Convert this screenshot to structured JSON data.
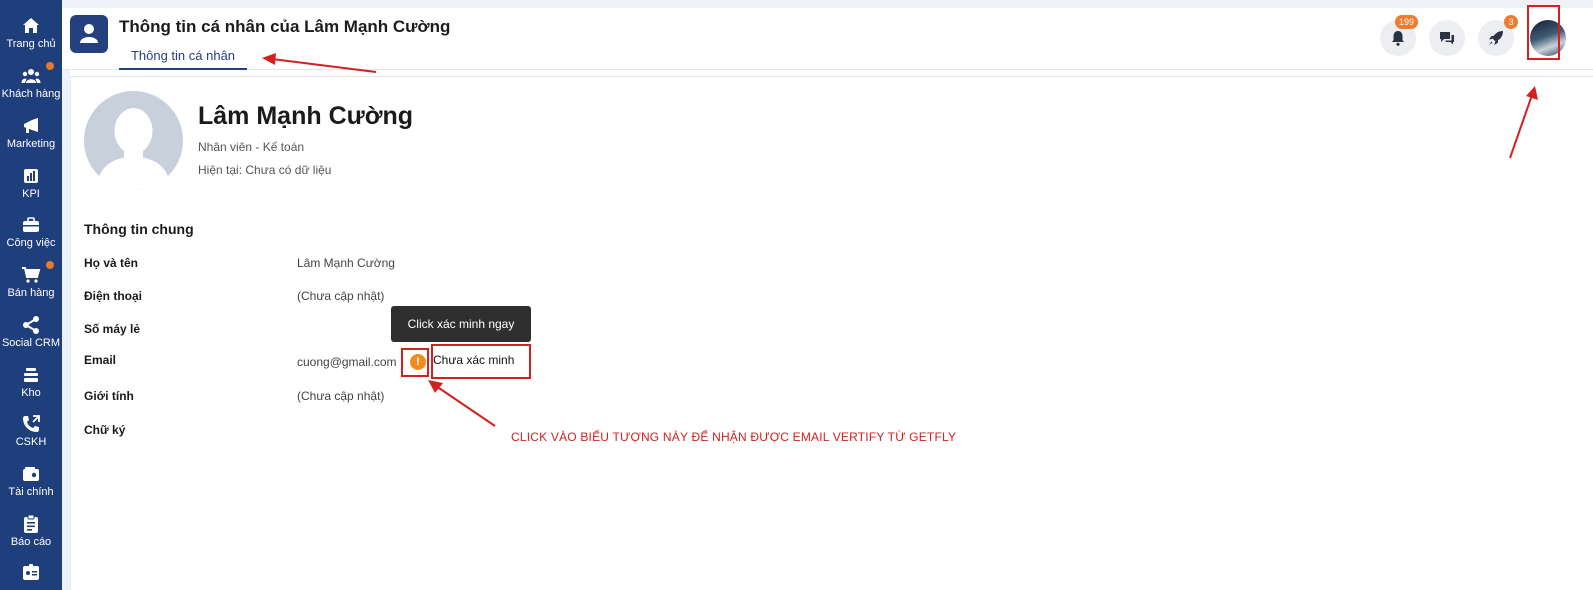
{
  "sidebar": {
    "items": [
      {
        "label": "Trang chủ",
        "icon": "home-icon",
        "dot": false
      },
      {
        "label": "Khách hàng",
        "icon": "users-icon",
        "dot": true
      },
      {
        "label": "Marketing",
        "icon": "megaphone-icon",
        "dot": false
      },
      {
        "label": "KPI",
        "icon": "bar-chart-icon",
        "dot": false
      },
      {
        "label": "Công việc",
        "icon": "briefcase-icon",
        "dot": false
      },
      {
        "label": "Bán hàng",
        "icon": "cart-icon",
        "dot": true
      },
      {
        "label": "Social CRM",
        "icon": "share-icon",
        "dot": false
      },
      {
        "label": "Kho",
        "icon": "stack-icon",
        "dot": false
      },
      {
        "label": "CSKH",
        "icon": "phone-icon",
        "dot": false
      },
      {
        "label": "Tài chính",
        "icon": "wallet-icon",
        "dot": false
      },
      {
        "label": "Báo cáo",
        "icon": "clipboard-icon",
        "dot": false
      }
    ],
    "accent": "#1f3f7c",
    "dot_color": "#e8782a"
  },
  "header": {
    "title": "Thông tin cá nhân của Lâm Mạnh Cường",
    "tab": "Thông tin cá nhân",
    "notification_count": "199",
    "rocket_count": "3"
  },
  "profile": {
    "name": "Lâm Mạnh Cường",
    "role": "Nhân viên - Kế toán",
    "current_label": "Hiện tại:",
    "current_value": "Chưa có dữ liệu"
  },
  "general": {
    "title": "Thông tin chung",
    "fields": [
      {
        "label": "Họ và tên",
        "value": "Lâm Mạnh Cường"
      },
      {
        "label": "Điện thoại",
        "value": "(Chưa cập nhật)"
      },
      {
        "label": "Số máy lẻ",
        "value": ""
      },
      {
        "label": "Email",
        "value": "cuong@gmail.com"
      },
      {
        "label": "Giới tính",
        "value": "(Chưa cập nhật)"
      },
      {
        "label": "Chữ ký",
        "value": ""
      }
    ],
    "email_status": "Chưa xác minh",
    "tooltip": "Click xác minh ngay",
    "verify_symbol": "!"
  },
  "annotation": {
    "instruction": "CLICK VÀO BIỂU TƯỢNG NÀY ĐỂ NHẬN ĐƯỢC EMAIL VERTIFY TỪ GETFLY",
    "color": "#d42020"
  }
}
